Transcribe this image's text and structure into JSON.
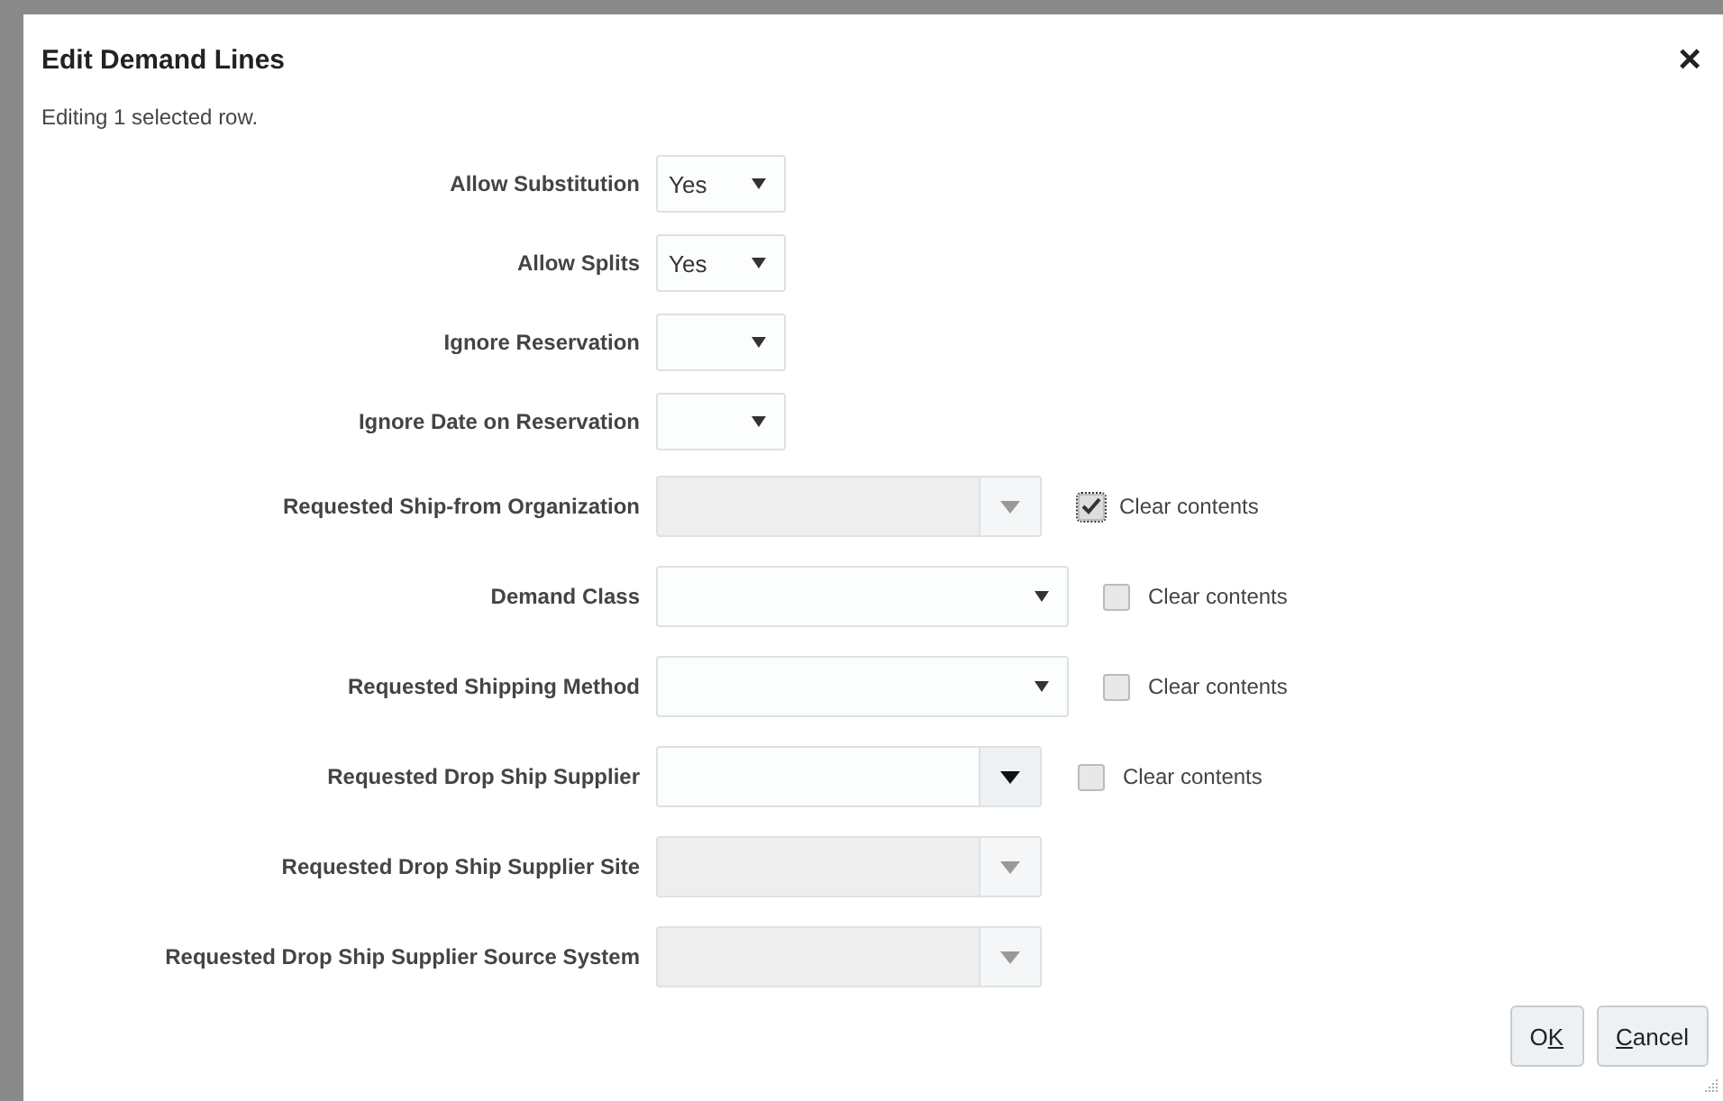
{
  "dialog": {
    "title": "Edit Demand Lines",
    "close": "×",
    "subtitle": "Editing 1 selected row."
  },
  "fields": [
    {
      "label": "Allow Substitution",
      "kind": "small",
      "value": "Yes"
    },
    {
      "label": "Allow Splits",
      "kind": "small",
      "value": "Yes"
    },
    {
      "label": "Ignore Reservation",
      "kind": "small"
    },
    {
      "label": "Ignore Date on Reservation",
      "kind": "small"
    },
    {
      "label": "Requested Ship-from Organization",
      "kind": "disabled",
      "clear": {
        "label": "Clear contents",
        "checked": true
      }
    },
    {
      "label": "Demand Class",
      "kind": "wide",
      "clear": {
        "label": "Clear contents",
        "checked": false
      }
    },
    {
      "label": "Requested Shipping Method",
      "kind": "wide",
      "clear": {
        "label": "Clear contents",
        "checked": false
      }
    },
    {
      "label": "Requested Drop Ship Supplier",
      "kind": "combo",
      "clear": {
        "label": "Clear contents",
        "checked": false
      }
    },
    {
      "label": "Requested Drop Ship Supplier Site",
      "kind": "disabled"
    },
    {
      "label": "Requested Drop Ship Supplier Source System",
      "kind": "disabled"
    }
  ],
  "buttons": [
    {
      "before": "O",
      "access_key": "K"
    },
    {
      "access_key": "C",
      "after": "ancel"
    }
  ]
}
